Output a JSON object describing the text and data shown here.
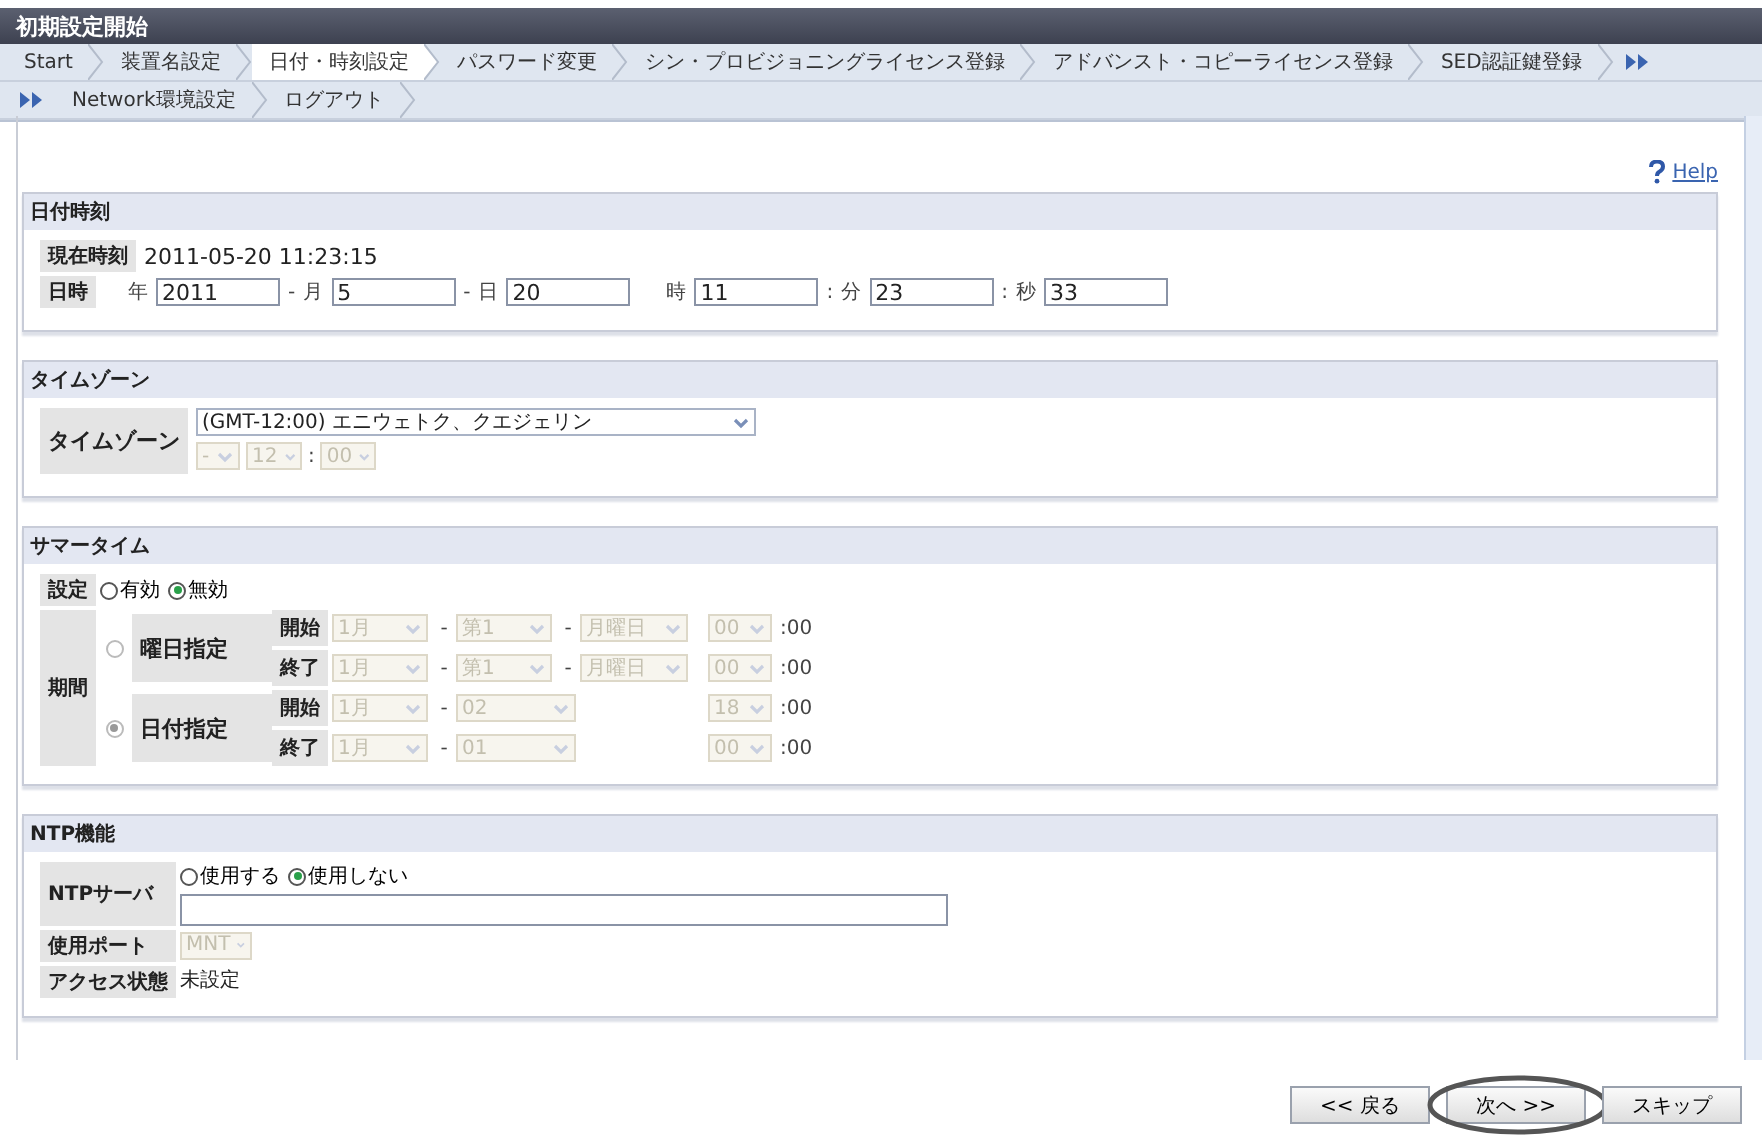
{
  "window": {
    "title": "初期設定開始"
  },
  "step_rows": [
    {
      "items": [
        {
          "label": "Start",
          "selected": false
        },
        {
          "label": "装置名設定",
          "selected": false
        },
        {
          "label": "日付・時刻設定",
          "selected": true
        },
        {
          "label": "パスワード変更",
          "selected": false
        },
        {
          "label": "シン・プロビジョニングライセンス登録",
          "selected": false
        },
        {
          "label": "アドバンスト・コピーライセンス登録",
          "selected": false
        },
        {
          "label": "SED認証鍵登録",
          "selected": false
        }
      ]
    },
    {
      "items": [
        {
          "label": "Network環境設定",
          "selected": false
        },
        {
          "label": "ログアウト",
          "selected": false
        }
      ]
    }
  ],
  "help": {
    "label": "Help"
  },
  "sections": [
    {
      "kind": "datetime",
      "title": "日付時刻",
      "current": {
        "label": "現在時刻",
        "value": "2011-05-20 11:23:15"
      },
      "datetime": {
        "label": "日時",
        "fields": [
          {
            "unit": "年",
            "value": "2011",
            "sep": "-"
          },
          {
            "unit": "月",
            "value": "5",
            "sep": "-"
          },
          {
            "unit": "日",
            "value": "20"
          },
          {
            "unit": "時",
            "value": "11",
            "sep": ":"
          },
          {
            "unit": "分",
            "value": "23",
            "sep": ":"
          },
          {
            "unit": "秒",
            "value": "33"
          }
        ]
      }
    },
    {
      "kind": "timezone",
      "title": "タイムゾーン",
      "label": "タイムゾーン",
      "zone": {
        "value": "(GMT-12:00) エニウェトク、クエジェリン",
        "disabled": false
      },
      "offset_sign": {
        "value": "-",
        "disabled": true
      },
      "offset_hour": {
        "value": "12",
        "disabled": true
      },
      "offset_sep": ":",
      "offset_minute": {
        "value": "00",
        "disabled": true
      }
    },
    {
      "kind": "summertime",
      "title": "サマータイム",
      "setting": {
        "label": "設定",
        "options": [
          {
            "label": "有効",
            "selected": false
          },
          {
            "label": "無効",
            "selected": true
          }
        ]
      },
      "period": {
        "label": "期間",
        "modes": [
          {
            "label": "曜日指定",
            "selected": false,
            "rows": [
              {
                "label": "開始",
                "month": {
                  "value": "1月",
                  "disabled": true
                },
                "sep1": "-",
                "week": {
                  "value": "第1",
                  "disabled": true
                },
                "sep2": "-",
                "weekday": {
                  "value": "月曜日",
                  "disabled": true
                },
                "hour": {
                  "value": "00",
                  "disabled": true
                },
                "minute": ":00"
              },
              {
                "label": "終了",
                "month": {
                  "value": "1月",
                  "disabled": true
                },
                "sep1": "-",
                "week": {
                  "value": "第1",
                  "disabled": true
                },
                "sep2": "-",
                "weekday": {
                  "value": "月曜日",
                  "disabled": true
                },
                "hour": {
                  "value": "00",
                  "disabled": true
                },
                "minute": ":00"
              }
            ]
          },
          {
            "label": "日付指定",
            "selected": true,
            "rows": [
              {
                "label": "開始",
                "month": {
                  "value": "1月",
                  "disabled": true
                },
                "sep1": "-",
                "date": {
                  "value": "02",
                  "disabled": true
                },
                "hour": {
                  "value": "18",
                  "disabled": true
                },
                "minute": ":00"
              },
              {
                "label": "終了",
                "month": {
                  "value": "1月",
                  "disabled": true
                },
                "sep1": "-",
                "date": {
                  "value": "01",
                  "disabled": true
                },
                "hour": {
                  "value": "00",
                  "disabled": true
                },
                "minute": ":00"
              }
            ]
          }
        ]
      }
    },
    {
      "kind": "ntp",
      "title": "NTP機能",
      "server": {
        "label": "NTPサーバ",
        "options": [
          {
            "label": "使用する",
            "selected": false
          },
          {
            "label": "使用しない",
            "selected": true
          }
        ]
      },
      "port": {
        "label": "使用ポート",
        "value": "MNT",
        "disabled": true
      },
      "access": {
        "label": "アクセス状態",
        "value": "未設定"
      }
    }
  ],
  "buttons": [
    {
      "label": "<< 戻る",
      "highlighted": false
    },
    {
      "label": "次へ >>",
      "highlighted": true
    },
    {
      "label": "スキップ",
      "highlighted": false
    }
  ]
}
